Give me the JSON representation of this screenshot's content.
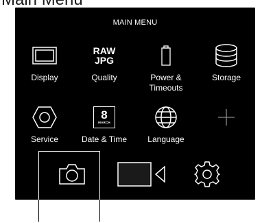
{
  "page_heading": "Main Menu",
  "menu_title": "MAIN MENU",
  "tiles": [
    {
      "label": "Display",
      "icon": "display-icon"
    },
    {
      "label": "Quality",
      "icon": "raw-jpg-icon",
      "icon_text": [
        "RAW",
        "JPG"
      ]
    },
    {
      "label": "Power & Timeouts",
      "icon": "battery-icon"
    },
    {
      "label": "Storage",
      "icon": "database-icon"
    },
    {
      "label": "Service",
      "icon": "hexagon-nut-icon"
    },
    {
      "label": "Date & Time",
      "icon": "calendar-icon",
      "date_day": "8",
      "date_month": "MARCH"
    },
    {
      "label": "Language",
      "icon": "globe-icon"
    },
    {
      "label": "",
      "icon": "plus-icon"
    }
  ],
  "bottom_bar": [
    {
      "icon": "camera-icon",
      "selected": true
    },
    {
      "icon": "video-camera-icon",
      "selected": false
    },
    {
      "icon": "gear-icon",
      "selected": false
    }
  ],
  "colors": {
    "screen_background": "#000000",
    "foreground": "#ffffff",
    "page_background": "#ffffff",
    "plus_icon": "#8a8a8a"
  }
}
